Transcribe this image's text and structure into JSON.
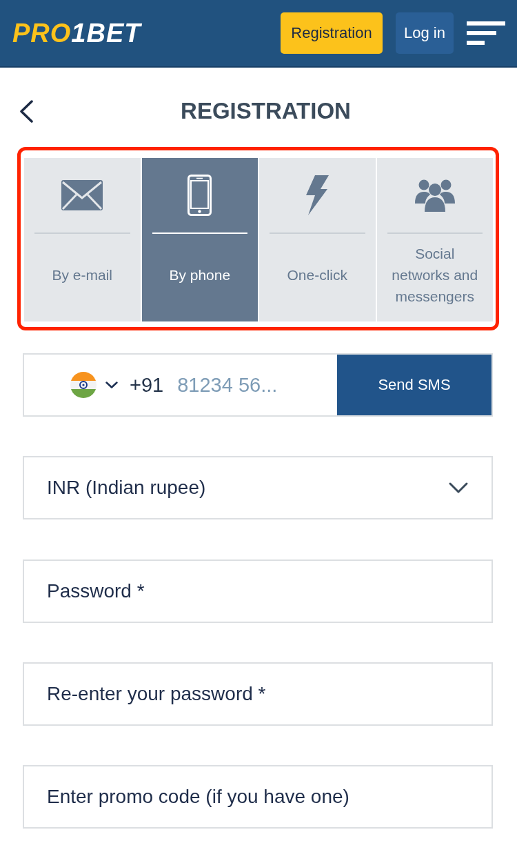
{
  "header": {
    "logo": {
      "accent": "PRO",
      "rest": "1BET"
    },
    "buttons": [
      {
        "label": "Registration",
        "kind": "primary"
      },
      {
        "label": "Log in",
        "kind": "secondary"
      }
    ]
  },
  "page": {
    "title": "REGISTRATION"
  },
  "methods": {
    "highlighted": true,
    "tabs": [
      {
        "label": "By e-mail",
        "kind": "email",
        "selected": false
      },
      {
        "label": "By phone",
        "kind": "phone",
        "selected": true
      },
      {
        "label": "One-click",
        "kind": "oneclick",
        "selected": false
      },
      {
        "label": "Social networks and messengers",
        "kind": "social",
        "selected": false
      }
    ]
  },
  "phone": {
    "country_code": "+91",
    "placeholder": "81234 56...",
    "button": "Send SMS"
  },
  "currency": {
    "value": "INR (Indian rupee)"
  },
  "fields": [
    {
      "placeholder": "Password *"
    },
    {
      "placeholder": "Re-enter your password *"
    },
    {
      "placeholder": "Enter promo code (if you have one)"
    }
  ]
}
